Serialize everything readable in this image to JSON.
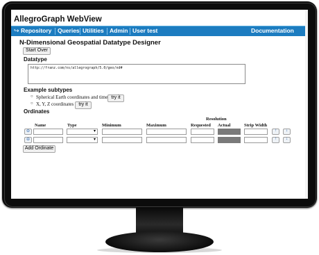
{
  "app": {
    "title": "AllegroGraph WebView"
  },
  "nav": {
    "back_icon": "back-arrow-icon",
    "items": [
      "Repository",
      "Queries",
      "Utilities",
      "Admin",
      "User test"
    ],
    "right": "Documentation"
  },
  "page": {
    "title": "N-Dimensional Geospatial Datatype Designer",
    "start_over": "Start Over"
  },
  "datatype": {
    "heading": "Datatype",
    "value": "http://franz.com/ns/allegrograph/5.0/geo/nd#"
  },
  "examples": {
    "heading": "Example subtypes",
    "items": [
      {
        "label": "Spherical Earth coordinates and time",
        "button": "try it"
      },
      {
        "label": "X, Y, Z coordinates",
        "button": "try it"
      }
    ]
  },
  "ordinates": {
    "heading": "Ordinates",
    "columns": {
      "name": "Name",
      "type": "Type",
      "minimum": "Minimum",
      "maximum": "Maximum",
      "resolution": "Resolution",
      "requested": "Requested",
      "actual": "Actual",
      "strip_width": "Strip Width"
    },
    "add_button": "Add Ordinate",
    "row_count": 2
  },
  "colors": {
    "nav_bar": "#1c7cc0",
    "actual_field": "#7a7a7a"
  }
}
